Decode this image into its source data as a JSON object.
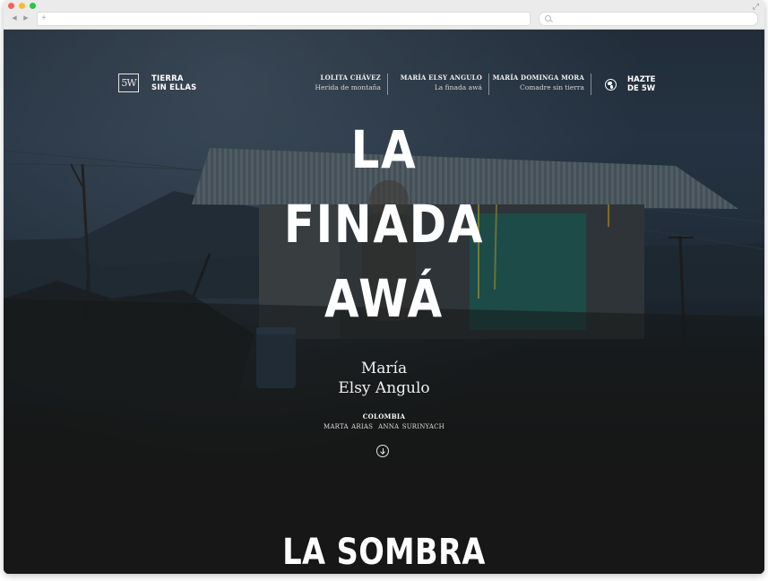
{
  "brand": {
    "logo_text": "5W",
    "name_line1": "TIERRA",
    "name_line2": "SIN ELLAS"
  },
  "nav": {
    "items": [
      {
        "name": "LOLITA CHÁVEZ",
        "subtitle": "Herida de montaña"
      },
      {
        "name": "MARÍA ELSY ANGULO",
        "subtitle": "La finada awá"
      },
      {
        "name": "MARÍA DOMINGA MORA",
        "subtitle": "Comadre sin tierra"
      }
    ],
    "join_line1": "HAZTE",
    "join_line2": "DE 5W",
    "join_icon": "globe-icon"
  },
  "hero": {
    "title_line1": "LA",
    "title_line2": "FINADA",
    "title_line3": "AWÁ",
    "author_line1": "María",
    "author_line2": "Elsy Angulo",
    "country": "COLOMBIA",
    "credit1": "MARTA ARIAS",
    "credit2": "ANNA SURINYACH",
    "scroll_icon": "arrow-down-circle-icon"
  },
  "next_section": {
    "title": "LA SOMBRA"
  },
  "browser": {
    "address_icon": "plus-icon",
    "search_icon": "search-icon"
  }
}
